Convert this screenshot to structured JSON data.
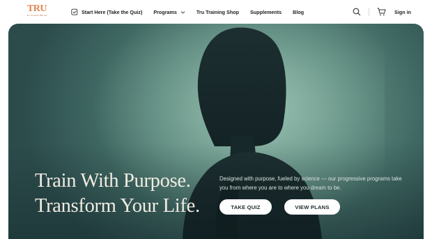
{
  "brand": {
    "logo_text": "TRU",
    "logo_subtext": "BY SUGAR BRUIN",
    "accent_color": "#e0864f"
  },
  "nav": {
    "items": [
      {
        "label": "Start Here (Take the Quiz)",
        "icon": "quiz-check-icon"
      },
      {
        "label": "Programs",
        "icon": "chevron-down-icon"
      },
      {
        "label": "Tru Training Shop"
      },
      {
        "label": "Supplements"
      },
      {
        "label": "Blog"
      }
    ]
  },
  "header_actions": {
    "search_icon": "search-icon",
    "cart_icon": "cart-icon",
    "signin_label": "Sign in"
  },
  "hero": {
    "headline_line1": "Train With Purpose.",
    "headline_line2": "Transform Your Life.",
    "subtext": "Designed with purpose, fueled by science — our progressive programs take you from where you are to where you dream to be.",
    "primary_button": "TAKE QUIZ",
    "secondary_button": "VIEW PLANS"
  }
}
